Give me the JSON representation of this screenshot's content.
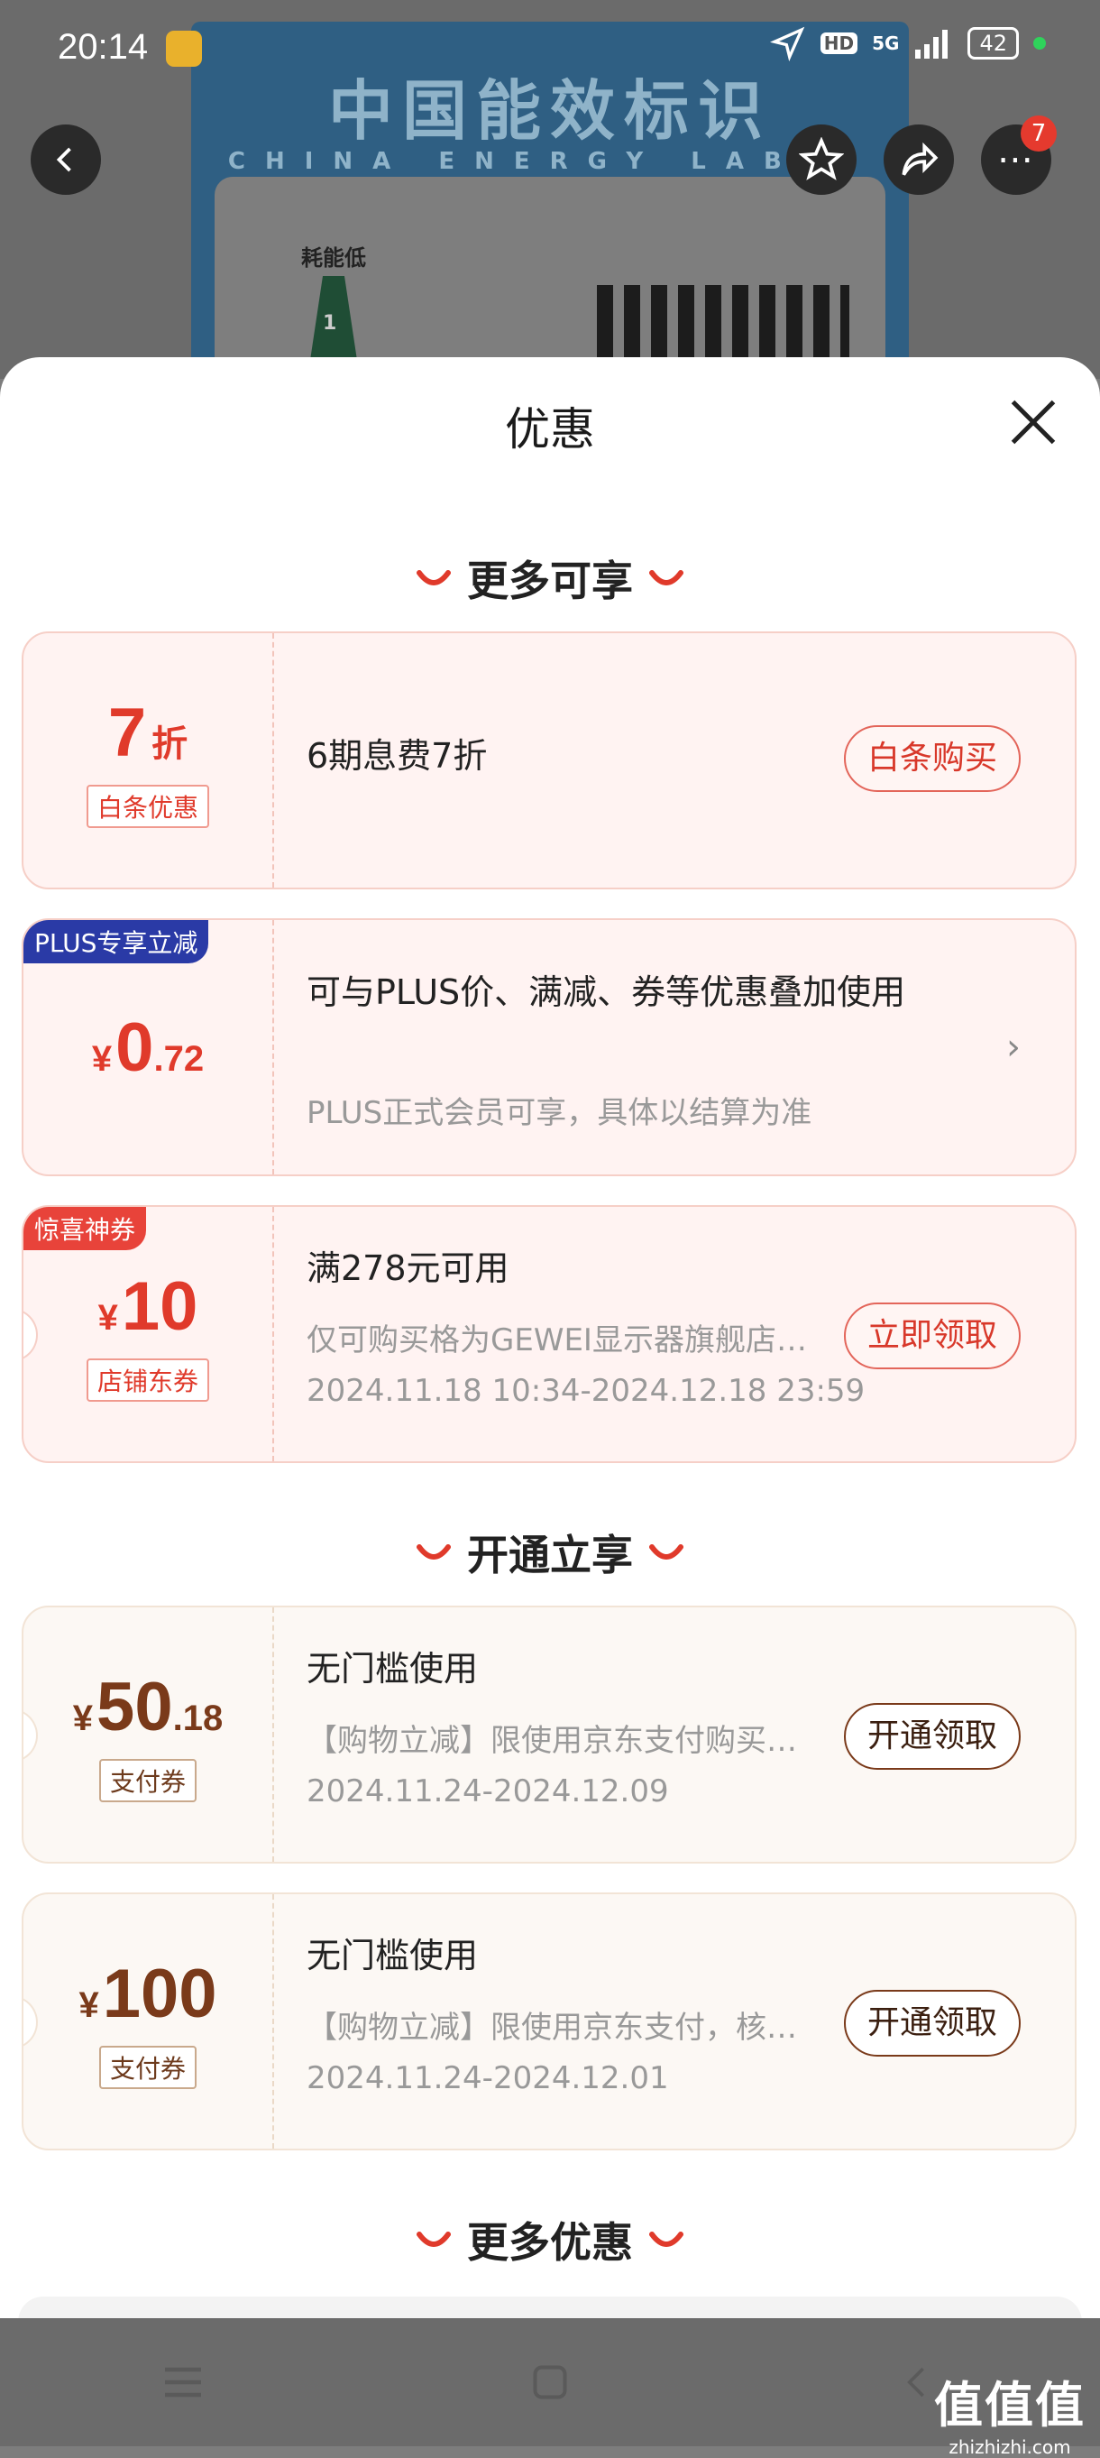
{
  "status_bar": {
    "time": "20:14",
    "hd": "HD",
    "network": "5G",
    "battery": "42"
  },
  "background": {
    "label_title": "中国能效标识",
    "label_sub": "CHINA ENERGY LABEL",
    "energy_text": "耗能低",
    "energy_grade": "1",
    "cart_badge": "7"
  },
  "sheet": {
    "title": "优惠",
    "sections": {
      "more_available": "更多可享",
      "open_enjoy": "开通立享",
      "more_offers": "更多优惠"
    },
    "cards": [
      {
        "id": "baitiao",
        "amount_num": "7",
        "amount_unit": "折",
        "tag": "白条优惠",
        "line1": "6期息费7折",
        "action": "白条购买"
      },
      {
        "id": "plus",
        "corner": "PLUS专享立减",
        "yen": "¥",
        "amount_num": "0",
        "amount_dec": ".72",
        "line1": "可与PLUS价、满减、券等优惠叠加使用",
        "line2": "PLUS正式会员可享，具体以结算为准"
      },
      {
        "id": "shop",
        "corner": "惊喜神券",
        "yen": "¥",
        "amount_num": "10",
        "tag": "店铺东券",
        "line1": "满278元可用",
        "line2": "仅可购买格为GEWEI显示器旗舰店…",
        "line3": "2024.11.18 10:34-2024.12.18 23:59",
        "action": "立即领取"
      },
      {
        "id": "pay50",
        "yen": "¥",
        "amount_num": "50",
        "amount_dec": ".18",
        "tag": "支付券",
        "line1": "无门槛使用",
        "line2": "【购物立减】限使用京东支付购买…",
        "line3": "2024.11.24-2024.12.09",
        "action": "开通领取"
      },
      {
        "id": "pay100",
        "yen": "¥",
        "amount_num": "100",
        "tag": "支付券",
        "line1": "无门槛使用",
        "line2": "【购物立减】限使用京东支付，核…",
        "line3": "2024.11.24-2024.12.01",
        "action": "开通领取"
      }
    ]
  },
  "watermark": {
    "text": "值值值",
    "sub": "zhizhizhi.com"
  },
  "colors": {
    "accent_red": "#e03a2b",
    "gold_text": "#7a3a1a",
    "plus_blue": "#2a3aa6"
  }
}
